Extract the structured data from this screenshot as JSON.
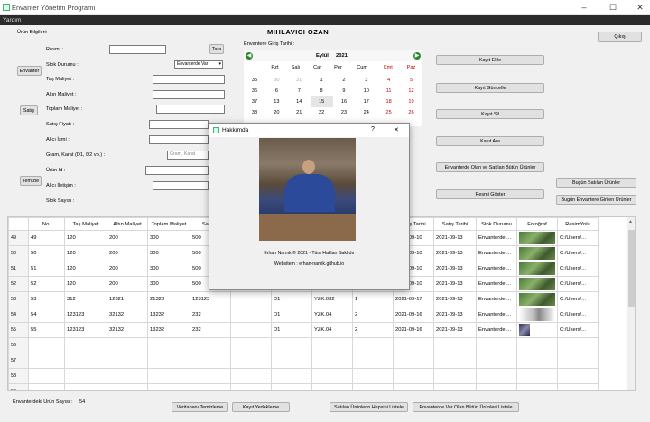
{
  "window": {
    "title": "Envanter Yönetim Programı"
  },
  "menu": {
    "help": "Yardım"
  },
  "form": {
    "section": "Ürün Bilgileri:",
    "header_name": "MIHLAVICI OZAN",
    "resim": "Resmi :",
    "tara": "Tara",
    "stok_durumu": "Stok Durumu :",
    "stok_select": "Envanterde Var",
    "envanter": "Envanter",
    "tas_maliyet": "Taş Maliyet :",
    "altin_maliyet": "Altın Maliyet :",
    "satis": "Satış",
    "toplam_maliyet": "Toplam Maliyet :",
    "satis_fiyati": "Satış Fiyatı :",
    "alici_ismi": "Alıcı İsmi :",
    "gram_karat": "Gram, Karat (D1, D2 vb.) :",
    "gram_placeholder": "Gram, Karat",
    "temizle": "Temizle",
    "urun_id": "Ürün Id :",
    "alici_iletisim": "Alıcı İletişim :",
    "stok_sayisi": "Stok Sayısı :",
    "giris_tarihi": "Envantere Giriş Tarihi :"
  },
  "calendar": {
    "month": "Eylül",
    "year": "2021",
    "days": [
      "Pzt",
      "Salı",
      "Çar",
      "Per",
      "Cum",
      "Cmt",
      "Paz"
    ],
    "weeks": [
      {
        "wk": "35",
        "d": [
          "30",
          "31",
          "1",
          "2",
          "3",
          "4",
          "5"
        ]
      },
      {
        "wk": "36",
        "d": [
          "6",
          "7",
          "8",
          "9",
          "10",
          "11",
          "12"
        ]
      },
      {
        "wk": "37",
        "d": [
          "13",
          "14",
          "15",
          "16",
          "17",
          "18",
          "19"
        ]
      },
      {
        "wk": "38",
        "d": [
          "20",
          "21",
          "22",
          "23",
          "24",
          "25",
          "26"
        ]
      }
    ],
    "selected": "15"
  },
  "buttons": {
    "cikis": "Çıkış",
    "kayit_ekle": "Kayıt Ekle",
    "kayit_guncelle": "Kayıt Güncelle",
    "kayit_sil": "Kayıt Sil",
    "kayit_ara": "Kayıt Ara",
    "envanter_olan_satilan": "Envanterde Olan ve Satılan Bütün Ürünler",
    "resmi_goster": "Resmi Göster",
    "bugun_satilan": "Bugün Satılan Ürünler",
    "bugun_girilen": "Bugün Envantere Girilen Ürünler",
    "veritabani_temizleme": "Veritabanı Temizleme",
    "kayit_yedekleme": "Kayıt Yedekleme",
    "satilan_hepsi": "Satılan Ürünlerin Hepsini Listele",
    "envanterde_var_hepsi": "Envanterde Var Olan Bütün Ürünleri Listele"
  },
  "table": {
    "columns": [
      "No.",
      "Taş Maliyet",
      "Altın Maliyet",
      "Toplam Maliyet",
      "Satış F",
      "",
      "",
      "",
      "Sayısı",
      "Giriş Tarihi",
      "Satış Tarihi",
      "Stok Durumu",
      "Fotoğraf",
      "ResimYolu"
    ],
    "rows": [
      {
        "n": "49",
        "c": [
          "49",
          "120",
          "200",
          "300",
          "500",
          "",
          "",
          "",
          "",
          "2021-09-10",
          "2021-09-13",
          "Envanterde ...",
          "a",
          "C:/Users/..."
        ]
      },
      {
        "n": "50",
        "c": [
          "50",
          "120",
          "200",
          "300",
          "500",
          "",
          "",
          "",
          "",
          "2021-09-10",
          "2021-09-13",
          "Envanterde ...",
          "a",
          "C:/Users/..."
        ]
      },
      {
        "n": "51",
        "c": [
          "51",
          "120",
          "200",
          "300",
          "500",
          "",
          "",
          "",
          "",
          "2021-09-10",
          "2021-09-13",
          "Envanterde ...",
          "a",
          "C:/Users/..."
        ]
      },
      {
        "n": "52",
        "c": [
          "52",
          "120",
          "200",
          "300",
          "500",
          "",
          "",
          "",
          "",
          "2021-09-10",
          "2021-09-13",
          "Envanterde ...",
          "a",
          "C:/Users/..."
        ]
      },
      {
        "n": "53",
        "c": [
          "53",
          "312",
          "12321",
          "21323",
          "123123",
          "",
          "D1",
          "YZK.032",
          "1",
          "2021-09-17",
          "2021-09-13",
          "Envanterde ...",
          "a",
          "C:/Users/..."
        ]
      },
      {
        "n": "54",
        "c": [
          "54",
          "123123",
          "32132",
          "13232",
          "232",
          "",
          "D1",
          "YZK.04",
          "2",
          "2021-09-16",
          "2021-09-13",
          "Envanterde ...",
          "b",
          "C:/Users/..."
        ]
      },
      {
        "n": "55",
        "c": [
          "55",
          "123123",
          "32132",
          "13232",
          "232",
          "",
          "D1",
          "YZK.04",
          "2",
          "2021-09-16",
          "2021-09-13",
          "Envanterde ...",
          "c",
          "C:/Users/..."
        ]
      },
      {
        "n": "56",
        "c": [
          "",
          "",
          "",
          "",
          "",
          "",
          "",
          "",
          "",
          "",
          "",
          "",
          "",
          ""
        ]
      },
      {
        "n": "57",
        "c": [
          "",
          "",
          "",
          "",
          "",
          "",
          "",
          "",
          "",
          "",
          "",
          "",
          "",
          ""
        ]
      },
      {
        "n": "58",
        "c": [
          "",
          "",
          "",
          "",
          "",
          "",
          "",
          "",
          "",
          "",
          "",
          "",
          "",
          ""
        ]
      },
      {
        "n": "59",
        "c": [
          "",
          "",
          "",
          "",
          "",
          "",
          "",
          "",
          "",
          "",
          "",
          "",
          "",
          ""
        ]
      }
    ]
  },
  "footer": {
    "label": "Envanterdeki Ürün Sayısı :",
    "count": "54"
  },
  "dialog": {
    "title": "Hakkımda",
    "help": "?",
    "close": "✕",
    "credit": "Erhan Namık © 2021 - Tüm Hakları Saklıdır",
    "website": "Websitem : erhan-namik.github.io"
  }
}
